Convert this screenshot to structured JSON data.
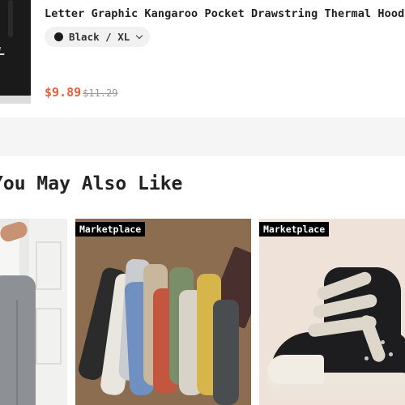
{
  "cart_item": {
    "title": "Letter Graphic Kangaroo Pocket Drawstring Thermal Hoodie",
    "variant": "Black / XL",
    "price_current": "$9.89",
    "price_original": "$11.29"
  },
  "recommendations": {
    "section_title": "You May Also Like",
    "cards": [
      {
        "badge": "",
        "image": "jeans-photo"
      },
      {
        "badge": "Marketplace",
        "image": "socks-photo"
      },
      {
        "badge": "Marketplace",
        "image": "sneaker-photo"
      }
    ]
  },
  "colors": {
    "price_accent": "#e8603c",
    "variant_color_swatch": "#1a1a1a"
  }
}
